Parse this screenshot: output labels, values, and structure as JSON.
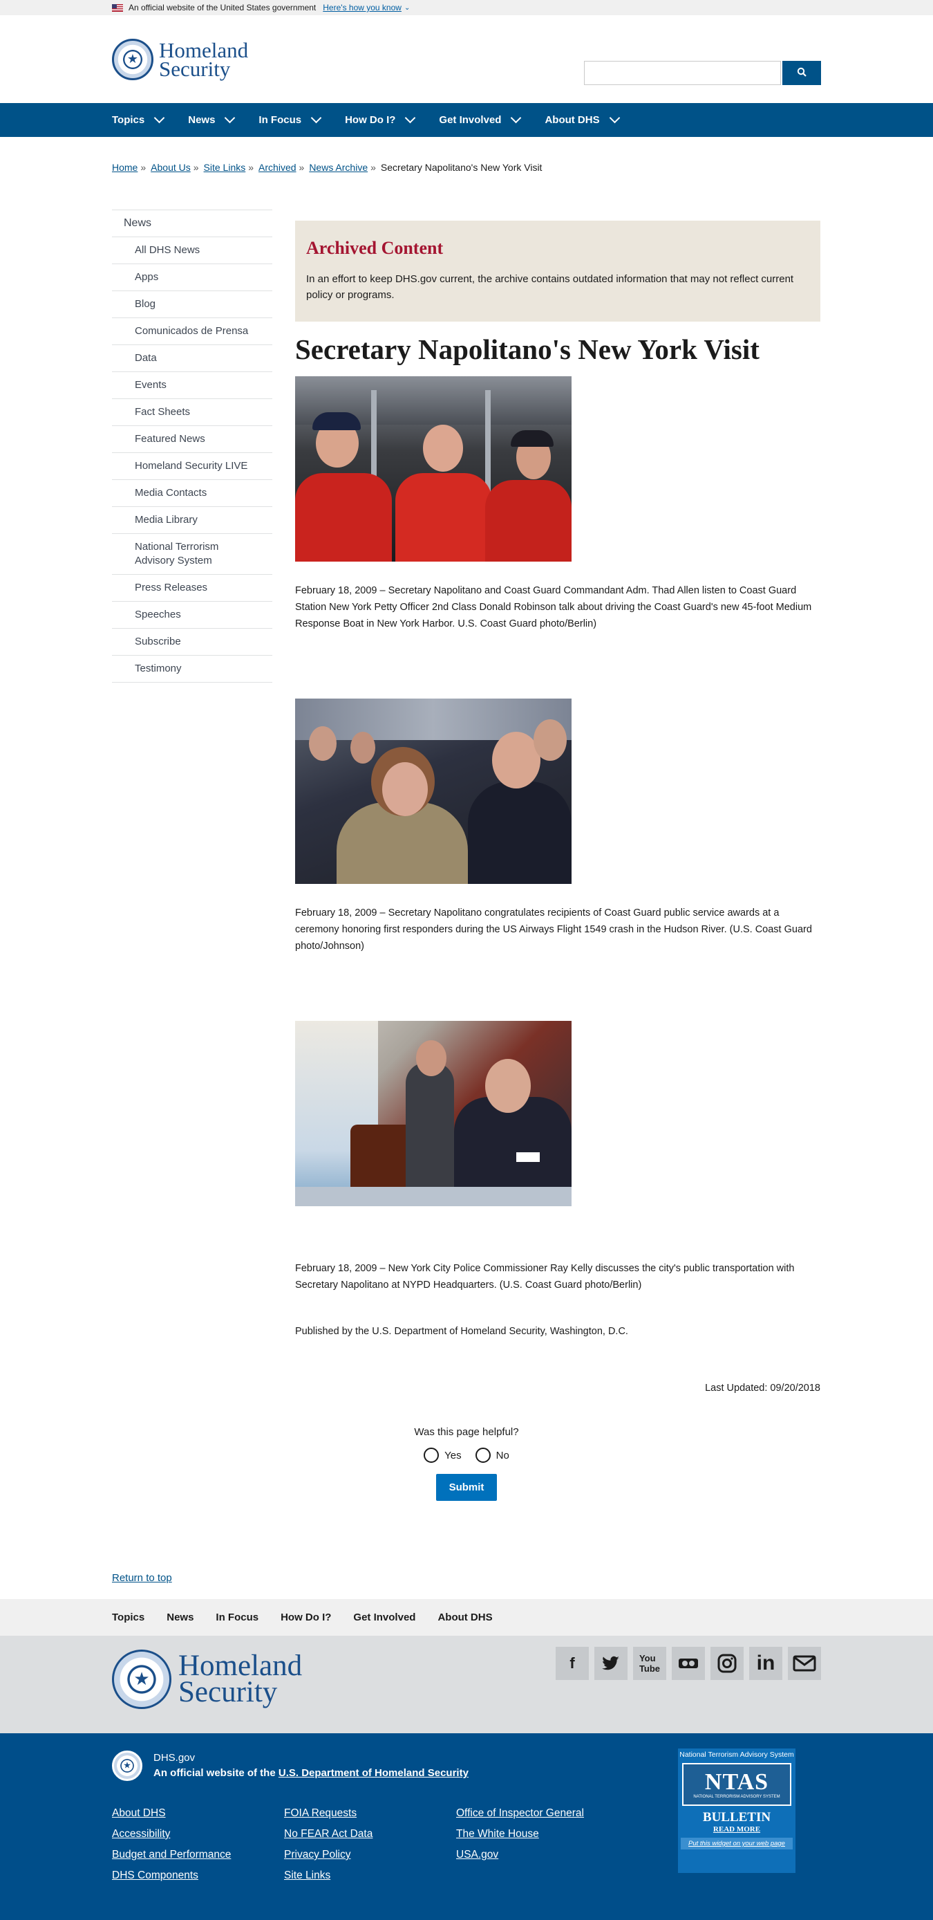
{
  "gov_banner": {
    "text": "An official website of the United States government",
    "how_link": "Here's how you know"
  },
  "header": {
    "logo_line1": "Homeland",
    "logo_line2": "Security",
    "search_placeholder": "",
    "search_icon": "search-icon"
  },
  "nav": {
    "items": [
      {
        "label": "Topics"
      },
      {
        "label": "News"
      },
      {
        "label": "In Focus"
      },
      {
        "label": "How Do I?"
      },
      {
        "label": "Get Involved"
      },
      {
        "label": "About DHS"
      }
    ]
  },
  "breadcrumb": {
    "items": [
      "Home",
      "About Us",
      "Site Links",
      "Archived",
      "News Archive"
    ],
    "current": "Secretary Napolitano's New York Visit"
  },
  "sidebar": {
    "heading": "News",
    "items": [
      "All DHS News",
      "Apps",
      "Blog",
      "Comunicados de Prensa",
      "Data",
      "Events",
      "Fact Sheets",
      "Featured News",
      "Homeland Security LIVE",
      "Media Contacts",
      "Media Library",
      "National Terrorism Advisory System",
      "Press Releases",
      "Speeches",
      "Subscribe",
      "Testimony"
    ]
  },
  "archived": {
    "title": "Archived Content",
    "body": "In an effort to keep DHS.gov current, the archive contains outdated information that may not reflect current policy or programs."
  },
  "page_title": "Secretary Napolitano's New York Visit",
  "captions": [
    "February 18, 2009 – Secretary Napolitano and Coast Guard Commandant Adm. Thad Allen listen to Coast Guard Station New York Petty Officer 2nd Class Donald Robinson talk about driving the Coast Guard's new 45-foot Medium Response Boat in New York Harbor. U.S. Coast Guard photo/Berlin)",
    "February 18, 2009 – Secretary Napolitano congratulates recipients of Coast Guard public service awards at a ceremony honoring first responders during the US Airways Flight 1549 crash in the Hudson River. (U.S. Coast Guard photo/Johnson)",
    "February 18, 2009 – New York City Police Commissioner Ray Kelly discusses the city's public transportation with Secretary Napolitano at NYPD Headquarters. (U.S. Coast Guard photo/Berlin)"
  ],
  "published": "Published by the U.S. Department of Homeland Security, Washington, D.C.",
  "last_updated": "Last Updated: 09/20/2018",
  "feedback": {
    "question": "Was this page helpful?",
    "yes": "Yes",
    "no": "No",
    "submit": "Submit"
  },
  "return_to_top": "Return to top",
  "footer_nav": [
    "Topics",
    "News",
    "In Focus",
    "How Do I?",
    "Get Involved",
    "About DHS"
  ],
  "social_icons": [
    "facebook-icon",
    "twitter-icon",
    "youtube-icon",
    "flickr-icon",
    "instagram-icon",
    "linkedin-icon",
    "email-icon"
  ],
  "footer": {
    "site": "DHS.gov",
    "official_prefix": "An official website of the ",
    "official_link": "U.S. Department of Homeland Security",
    "links": [
      "About DHS",
      "FOIA Requests",
      "Office of Inspector General",
      "Accessibility",
      "No FEAR Act Data",
      "The White House",
      "Budget and Performance",
      "Privacy Policy",
      "USA.gov",
      "DHS Components",
      "Site Links"
    ]
  },
  "ntas": {
    "header": "National Terrorism Advisory System",
    "logo": "NTAS",
    "logo_sub": "NATIONAL TERRORISM ADVISORY SYSTEM",
    "bulletin": "BULLETIN",
    "read_more": "READ MORE",
    "widget": "Put this widget on your web page"
  }
}
